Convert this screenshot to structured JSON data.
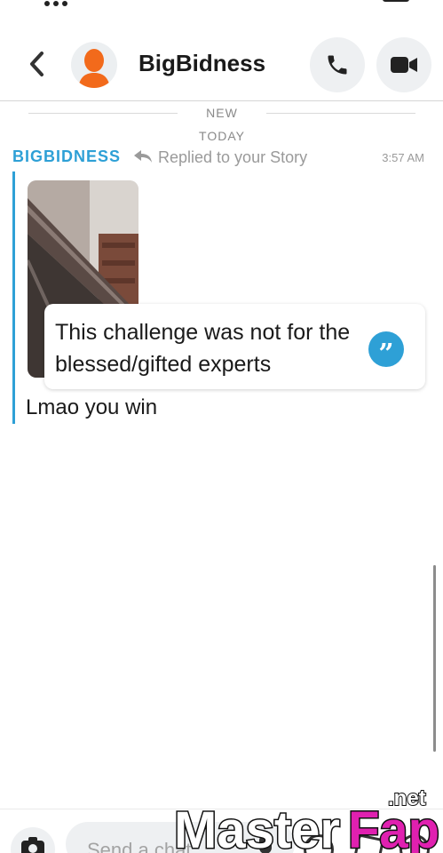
{
  "header": {
    "title": "BigBidness"
  },
  "divider": {
    "new_label": "NEW",
    "day_label": "TODAY"
  },
  "message": {
    "sender": "BIGBIDNESS",
    "reply_label": "Replied to your Story",
    "time": "3:57 AM",
    "story_caption": "This challenge was not for the blessed/gifted experts",
    "text": "Lmao you win"
  },
  "composer": {
    "placeholder": "Send a chat"
  },
  "watermark": {
    "text": "MasterFap",
    "suffix": ".net"
  },
  "colors": {
    "accent": "#2ea0d6",
    "avatar": "#f26a1b",
    "watermark_pink": "#e020b0"
  },
  "icons": {
    "back": "chevron-left-icon",
    "call": "phone-icon",
    "video": "video-camera-icon",
    "reply": "reply-arrow-icon",
    "quote": "quote-icon",
    "camera": "camera-icon",
    "mic": "microphone-icon",
    "emoji": "emoji-icon",
    "sticker": "sticker-icon",
    "plus": "plus-icon"
  }
}
